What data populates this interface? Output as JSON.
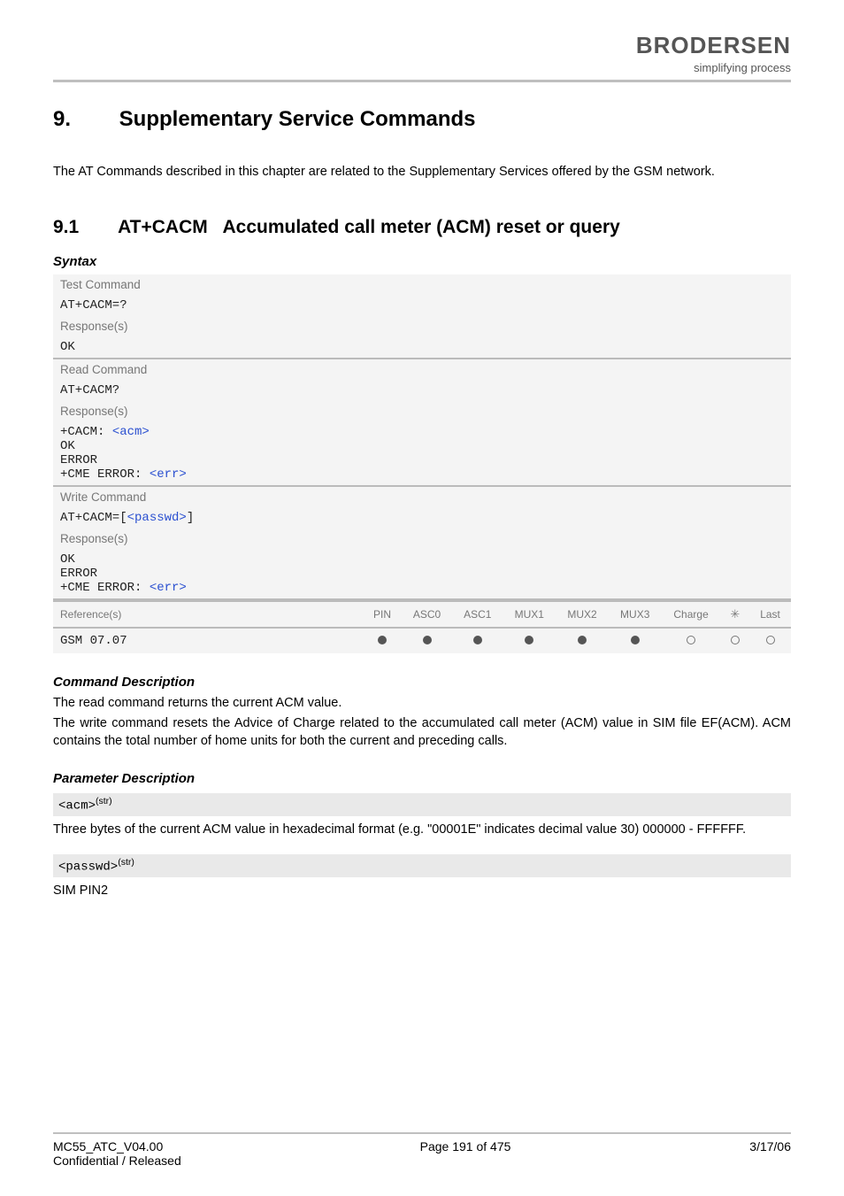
{
  "logo": {
    "brand": "BRODERSEN",
    "tagline": "simplifying process"
  },
  "chapter": {
    "num": "9.",
    "title": "Supplementary Service Commands"
  },
  "intro": "The AT Commands described in this chapter are related to the Supplementary Services offered by the GSM network.",
  "section": {
    "num": "9.1",
    "cmd": "AT+CACM",
    "title": "Accumulated call meter (ACM) reset or query"
  },
  "labels": {
    "syntax": "Syntax",
    "test_command": "Test Command",
    "read_command": "Read Command",
    "write_command": "Write Command",
    "responses": "Response(s)",
    "references": "Reference(s)",
    "cmd_desc": "Command Description",
    "param_desc": "Parameter Description"
  },
  "syntax": {
    "test": {
      "cmd": "AT+CACM=?",
      "resp": [
        "OK"
      ]
    },
    "read": {
      "cmd": "AT+CACM?",
      "resp_pre": "+CACM: ",
      "resp_param": "<acm>",
      "resp_rest": [
        "OK",
        "ERROR",
        "+CME ERROR: "
      ],
      "err_param": "<err>"
    },
    "write": {
      "cmd_pre": "AT+CACM=[",
      "cmd_param": "<passwd>",
      "cmd_post": "]",
      "resp": [
        "OK",
        "ERROR",
        "+CME ERROR: "
      ],
      "err_param": "<err>"
    }
  },
  "ref": {
    "value": "GSM 07.07",
    "headers": [
      "PIN",
      "ASC0",
      "ASC1",
      "MUX1",
      "MUX2",
      "MUX3",
      "Charge",
      "⚙",
      "Last"
    ],
    "dots": [
      "filled",
      "filled",
      "filled",
      "filled",
      "filled",
      "filled",
      "open",
      "open",
      "open"
    ]
  },
  "cmd_desc": {
    "p1": "The read command returns the current ACM value.",
    "p2": "The write command resets the Advice of Charge related to the accumulated call meter (ACM) value in SIM file EF(ACM). ACM contains the total number of home units for both the current and preceding calls."
  },
  "params": {
    "acm": {
      "name": "<acm>",
      "type": "(str)",
      "desc": "Three bytes of the current ACM value in hexadecimal format (e.g. \"00001E\" indicates decimal value 30) 000000 - FFFFFF."
    },
    "passwd": {
      "name": "<passwd>",
      "type": "(str)",
      "desc": "SIM PIN2"
    }
  },
  "footer": {
    "left1": "MC55_ATC_V04.00",
    "left2": "Confidential / Released",
    "center": "Page 191 of 475",
    "right": "3/17/06"
  }
}
